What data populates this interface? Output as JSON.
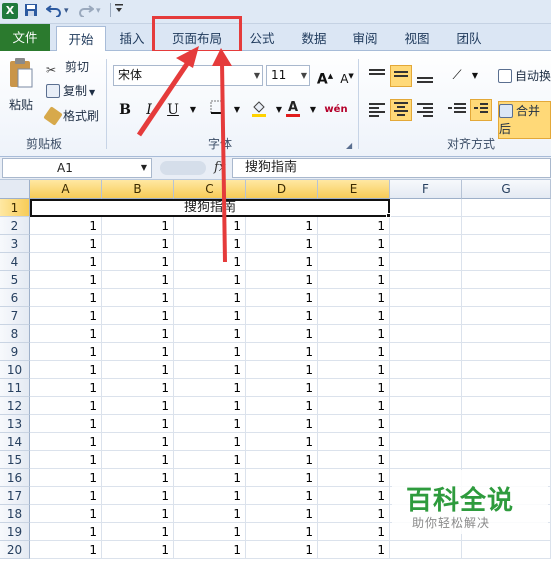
{
  "qat": {
    "dropdown_glyph": "▾"
  },
  "tabs": [
    {
      "label": "文件"
    },
    {
      "label": "开始"
    },
    {
      "label": "插入"
    },
    {
      "label": "页面布局"
    },
    {
      "label": "公式"
    },
    {
      "label": "数据"
    },
    {
      "label": "审阅"
    },
    {
      "label": "视图"
    },
    {
      "label": "团队"
    }
  ],
  "ribbon": {
    "clipboard": {
      "paste": "粘贴",
      "cut": "剪切",
      "copy": "复制",
      "format_painter": "格式刷",
      "group": "剪贴板"
    },
    "font": {
      "name": "宋体",
      "size": "11",
      "group": "字体",
      "bold": "B",
      "italic": "I",
      "underline": "U",
      "wen": "wén"
    },
    "alignment": {
      "wrap": "自动换",
      "merge": "合并后",
      "group": "对齐方式"
    }
  },
  "formula_bar": {
    "name_box": "A1",
    "fx": "fx",
    "content": "搜狗指南"
  },
  "grid": {
    "columns": [
      "A",
      "B",
      "C",
      "D",
      "E",
      "F",
      "G"
    ],
    "rows": [
      "1",
      "2",
      "3",
      "4",
      "5",
      "6",
      "7",
      "8",
      "9",
      "10",
      "11",
      "12",
      "13",
      "14",
      "15",
      "16",
      "17",
      "18",
      "19",
      "20"
    ],
    "merged_title": "搜狗指南",
    "cell_value": "1"
  },
  "watermark": {
    "title": "百科全说",
    "subtitle": "助你轻松解决"
  },
  "colors": {
    "file_tab": "#2b7a2e",
    "highlight": "#e53b3b",
    "selection": "#f7cc57"
  }
}
